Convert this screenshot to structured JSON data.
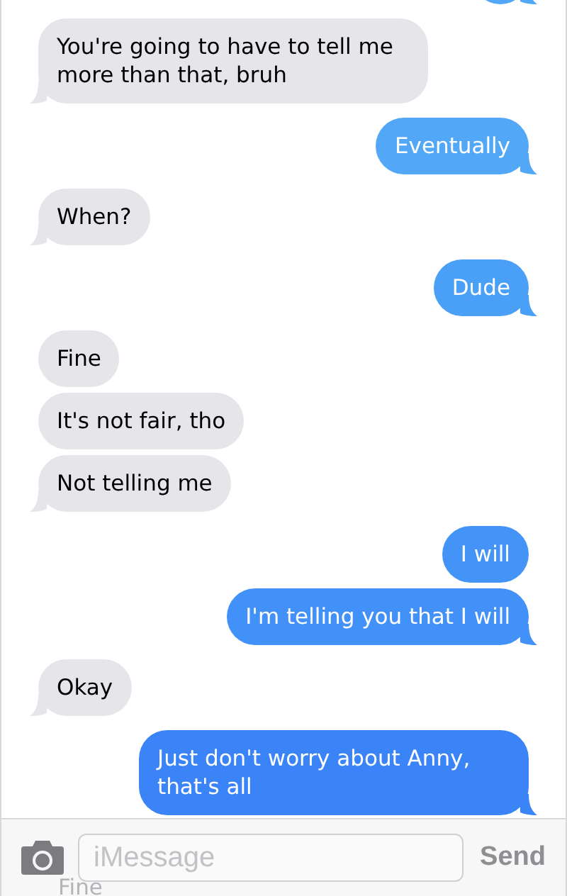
{
  "messages": [
    {
      "kind": "sent",
      "color": "#52a8f7",
      "tail": true
    },
    {
      "kind": "received",
      "text": "You're going to have to tell me more than that, bruh",
      "tail": true
    },
    {
      "kind": "sent",
      "color": "#52a8f7",
      "text": "Eventually",
      "tail": true
    },
    {
      "kind": "received",
      "text": "When?",
      "tail": true
    },
    {
      "kind": "sent",
      "color": "#4a9ff7",
      "text": "Dude",
      "tail": true
    },
    {
      "kind": "received",
      "text": "Fine",
      "tail": false
    },
    {
      "kind": "received",
      "text": "It's not fair, tho",
      "tail": false
    },
    {
      "kind": "received",
      "text": "Not telling me",
      "tail": true
    },
    {
      "kind": "sent",
      "color": "#4494f8",
      "text": "I will",
      "tail": false
    },
    {
      "kind": "sent",
      "color": "#4291f8",
      "text": "I'm telling you that I will",
      "tail": true
    },
    {
      "kind": "received",
      "text": "Okay",
      "tail": true
    },
    {
      "kind": "sent",
      "color": "#3a84f8",
      "text": "Just don't worry about Anny, that's all",
      "tail": true
    }
  ],
  "input_bar": {
    "placeholder": "iMessage",
    "send": "Send",
    "ghost_text": "Fine"
  }
}
